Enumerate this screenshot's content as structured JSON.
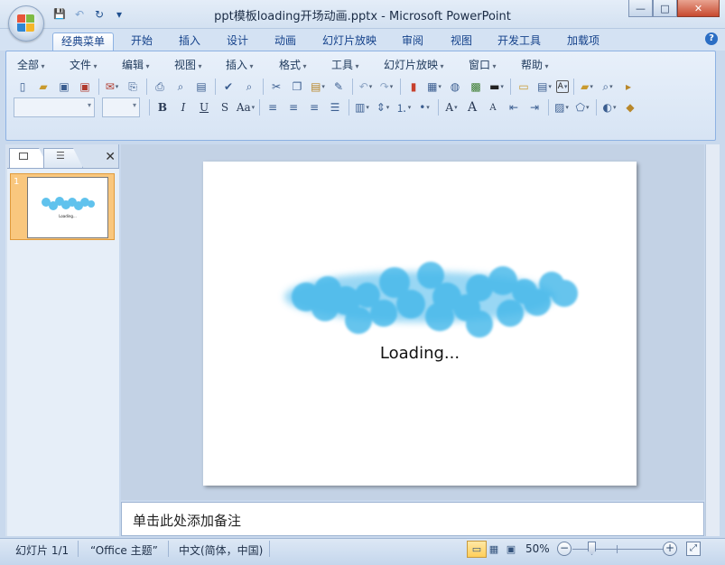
{
  "window": {
    "title": "ppt模板loading开场动画.pptx - Microsoft PowerPoint",
    "controls": {
      "minimize": "—",
      "maximize": "□",
      "close": "✕"
    }
  },
  "quick_access": {
    "save": "💾",
    "undo": "↶",
    "redo": "↻",
    "customize": "▾"
  },
  "ribbon_tabs": [
    "经典菜单",
    "开始",
    "插入",
    "设计",
    "动画",
    "幻灯片放映",
    "审阅",
    "视图",
    "开发工具",
    "加载项"
  ],
  "active_tab": "经典菜单",
  "help": "?",
  "classic_menus": [
    "全部",
    "文件",
    "编辑",
    "视图",
    "插入",
    "格式",
    "工具",
    "幻灯片放映",
    "窗口",
    "帮助"
  ],
  "toolbar_format": {
    "bold": "B",
    "italic": "I",
    "underline": "U",
    "shadow": "S",
    "change_case": "Aa",
    "font_grow": "A",
    "font_shrink": "A"
  },
  "panel": {
    "close": "✕"
  },
  "thumbnails": [
    {
      "number": "1",
      "caption": "Loading..."
    }
  ],
  "slide": {
    "text": "Loading..."
  },
  "notes": {
    "placeholder": "单击此处添加备注"
  },
  "status": {
    "slide_info": "幻灯片 1/1",
    "theme": "“Office 主题”",
    "language": "中文(简体，中国)",
    "zoom": "50%",
    "zoom_minus": "−",
    "zoom_plus": "+"
  },
  "colors": {
    "bubble": "#45b8ea",
    "ribbon": "#dbe7f5",
    "thumb_selected": "#f9c77e"
  }
}
